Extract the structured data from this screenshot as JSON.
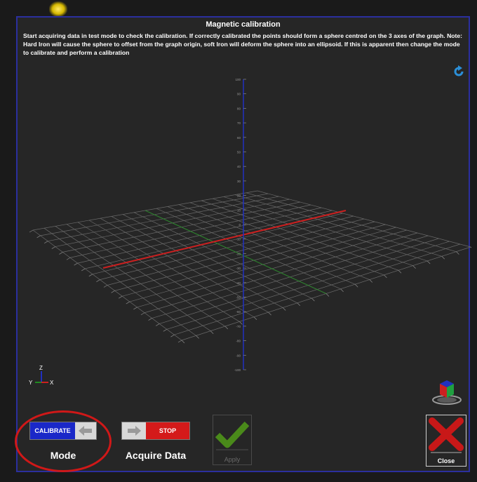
{
  "window": {
    "title": "Magnetic calibration",
    "description": "Start acquiring data in test mode to check the calibration. If correctly calibrated the points should form a sphere centred on the 3 axes of the graph. Note: Hard Iron will cause the sphere to offset from the graph origin, soft Iron will deform the sphere into an ellipsoid. If this is apparent then change the mode to calibrate and perform a calibration"
  },
  "plot": {
    "z_ticks": [
      "100",
      "90",
      "80",
      "70",
      "60",
      "50",
      "40",
      "30",
      "20",
      "10",
      "0",
      "-10",
      "-20",
      "-30",
      "-40",
      "-50",
      "-60",
      "-70",
      "-80",
      "-90",
      "-100"
    ],
    "x_axis_color": "#cc2020",
    "y_axis_color": "#208a20",
    "z_axis_color": "#2030c0"
  },
  "axis_indicator": {
    "z": "Z",
    "y": "Y",
    "x": "X"
  },
  "controls": {
    "mode_button_label": "CALIBRATE",
    "mode_label": "Mode",
    "acquire_button_label": "STOP",
    "acquire_label": "Acquire Data",
    "apply_label": "Apply",
    "close_label": "Close"
  },
  "icons": {
    "refresh": "refresh-icon",
    "mode_arrow": "arrow-left-icon",
    "acquire_arrow": "arrow-right-icon",
    "apply": "checkmark-icon",
    "close": "close-x-icon",
    "view_cube": "view-cube-icon"
  },
  "colors": {
    "window_border": "#2b2f9e",
    "calibrate_blue": "#1a28c8",
    "stop_red": "#d41a1a",
    "highlight_circle": "#d01818"
  }
}
